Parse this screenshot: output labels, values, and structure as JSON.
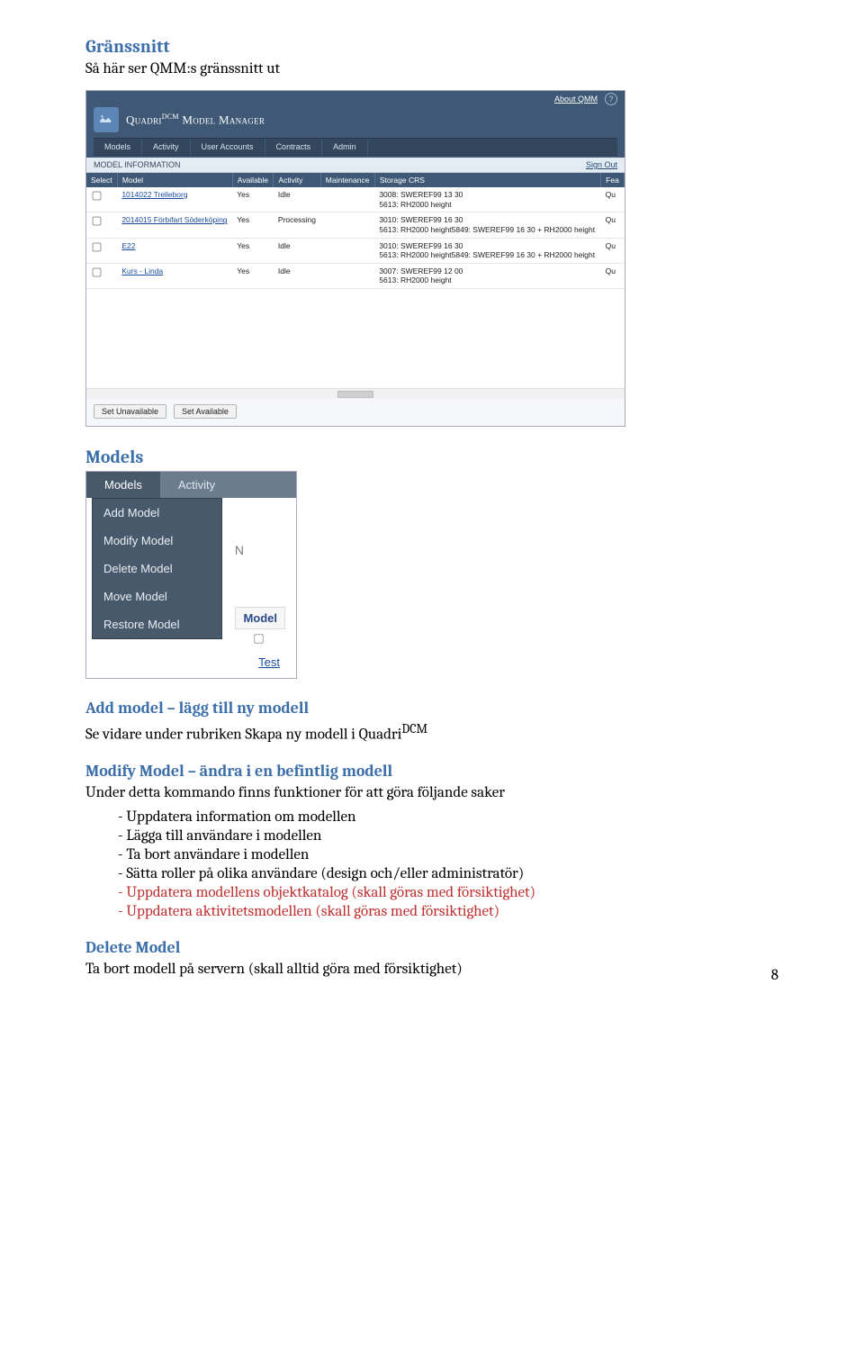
{
  "page_number": "8",
  "headings": {
    "granssnitt": "Gränssnitt",
    "granssnitt_sub": "Så här ser QMM:s gränssnitt ut",
    "models": "Models",
    "add_model": "Add model – lägg till ny modell",
    "add_model_body_1": "Se vidare under rubriken Skapa ny modell i Quadri",
    "add_model_sup": "DCM",
    "modify_model": "Modify Model – ändra i en befintlig modell",
    "modify_body": "Under detta kommando finns funktioner för att göra följande saker",
    "delete_model": "Delete Model",
    "delete_body": "Ta bort modell på servern (skall alltid göra med försiktighet)"
  },
  "bullets": [
    {
      "text": "Uppdatera information om modellen"
    },
    {
      "text": "Lägga till användare i modellen"
    },
    {
      "text": "Ta bort användare i modellen"
    },
    {
      "text": "Sätta roller på olika användare (design och/eller administratör)"
    },
    {
      "text": "Uppdatera modellens objektkatalog (skall göras med försiktighet)",
      "red": true
    },
    {
      "text": "Uppdatera aktivitetsmodellen (skall göras med försiktighet)",
      "red": true
    }
  ],
  "qmm": {
    "about": "About QMM",
    "title_a": "Quadri",
    "title_sup": "DCM",
    "title_b": " Model Manager",
    "nav": [
      "Models",
      "Activity",
      "User Accounts",
      "Contracts",
      "Admin"
    ],
    "model_info": "MODEL INFORMATION",
    "sign_out": "Sign Out",
    "cols": [
      "Select",
      "Model",
      "Available",
      "Activity",
      "Maintenance",
      "Storage CRS",
      "Fea"
    ],
    "rows": [
      {
        "model": "1014022 Trelleborg",
        "avail": "Yes",
        "act": "Idle",
        "maint": "",
        "crs": "3008: SWEREF99 13 30\n5613: RH2000 height",
        "feat": "Qu"
      },
      {
        "model": "2014015 Förbifart Söderköping",
        "avail": "Yes",
        "act": "Processing",
        "maint": "",
        "crs": "3010: SWEREF99 16 30\n5613: RH2000 height5849: SWEREF99 16 30 + RH2000 height",
        "feat": "Qu"
      },
      {
        "model": "E22",
        "avail": "Yes",
        "act": "Idle",
        "maint": "",
        "crs": "3010: SWEREF99 16 30\n5613: RH2000 height5849: SWEREF99 16 30 + RH2000 height",
        "feat": "Qu"
      },
      {
        "model": "Kurs - Linda",
        "avail": "Yes",
        "act": "Idle",
        "maint": "",
        "crs": "3007: SWEREF99 12 00\n5613: RH2000 height",
        "feat": "Qu"
      }
    ],
    "btn_unavail": "Set Unavailable",
    "btn_avail": "Set Available"
  },
  "dd": {
    "tabs": [
      "Models",
      "Activity"
    ],
    "items": [
      "Add Model",
      "Modify Model",
      "Delete Model",
      "Move Model",
      "Restore Model"
    ],
    "bg_n": "N",
    "bg_model": "Model",
    "bg_test": "Test"
  }
}
